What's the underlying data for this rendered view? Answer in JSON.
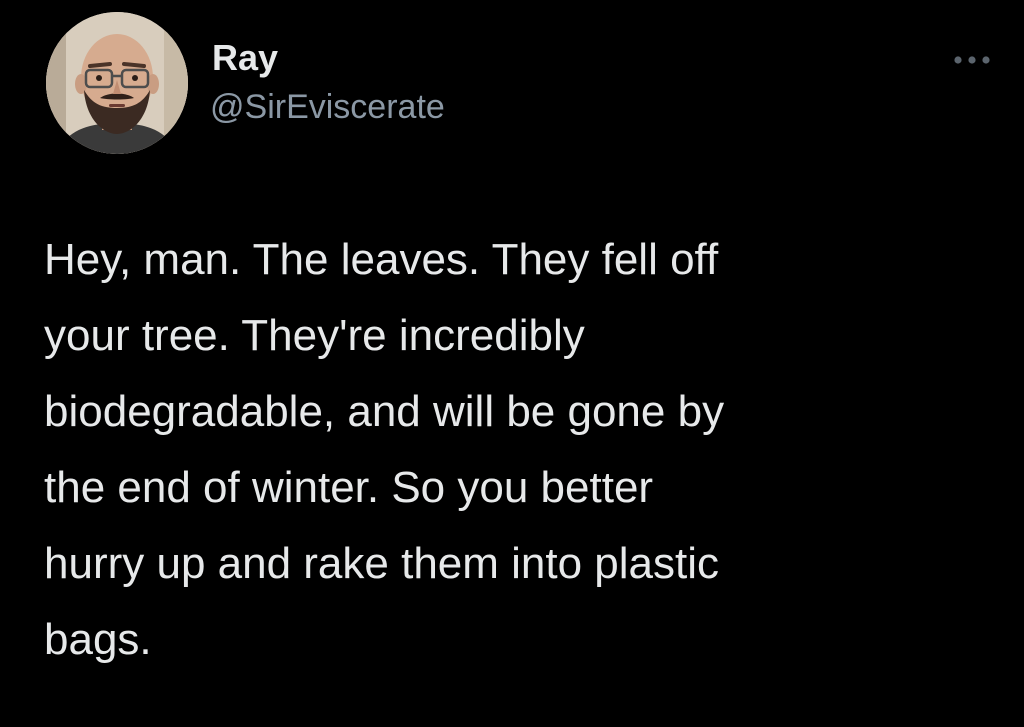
{
  "author": {
    "display_name": "Ray",
    "handle": "@SirEviscerate",
    "avatar_icon": "profile-photo"
  },
  "tweet": {
    "text": "Hey, man. The leaves. They fell off\nyour tree. They're incredibly\nbiodegradable, and will be gone by\nthe end of winter. So you better\nhurry up and rake them into plastic\nbags."
  },
  "more_icon": "more-horizontal-icon",
  "colors": {
    "background": "#000000",
    "primary_text": "#e7e9ea",
    "secondary_text": "#8b98a5"
  }
}
